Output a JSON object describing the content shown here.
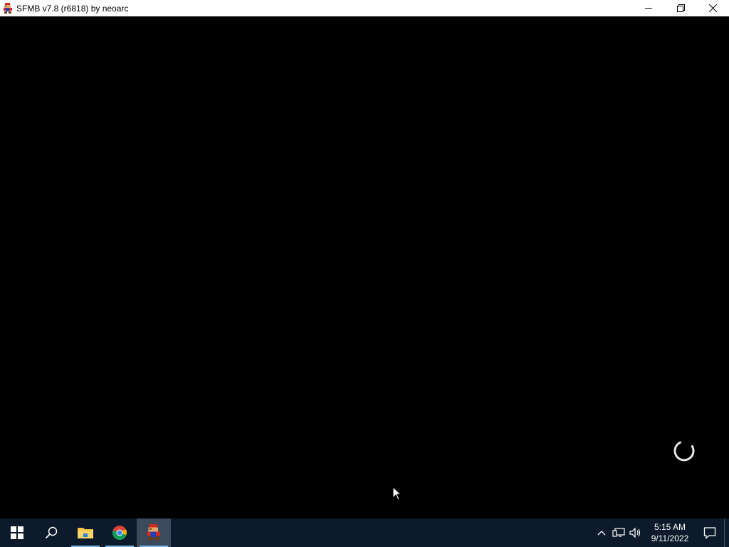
{
  "window": {
    "title": "SFMB v7.8 (r6818) by neoarc",
    "icon": "mario-icon"
  },
  "controls": {
    "minimize": "minimize-icon",
    "maximize": "restore-icon",
    "close": "close-icon"
  },
  "game": {
    "background": "#000000",
    "state": "loading"
  },
  "taskbar": {
    "items": [
      "windows-start-icon",
      "search-icon",
      "file-explorer-icon",
      "chrome-icon",
      "sfmb-app-icon"
    ],
    "active": "sfmb-app-icon",
    "accent": "#76b9ed",
    "background": "#0d1a2b"
  },
  "tray": {
    "time": "5:15 AM",
    "date": "9/11/2022"
  }
}
